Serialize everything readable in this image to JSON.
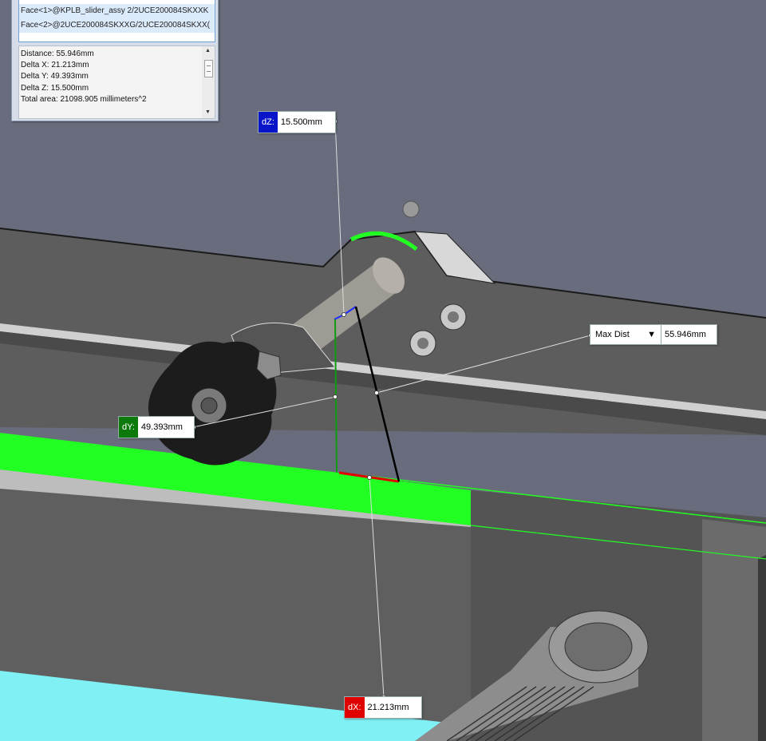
{
  "measure_panel": {
    "selections": [
      "Face<1>@KPLB_slider_assy 2/2UCE200084SKXXK",
      "Face<2>@2UCE200084SKXXG/2UCE200084SKXX("
    ],
    "results": [
      "Distance: 55.946mm",
      "Delta X: 21.213mm",
      "Delta Y: 49.393mm",
      "Delta Z: 15.500mm",
      "Total area: 21098.905 millimeters^2"
    ],
    "scroll_up_icon": "▲",
    "scroll_down_icon": "▼"
  },
  "callouts": {
    "dz": {
      "tag": "dZ:",
      "value": "15.500mm",
      "color": "#0a14c8"
    },
    "dy": {
      "tag": "dY:",
      "value": "49.393mm",
      "color": "#0b7a0b"
    },
    "dx": {
      "tag": "dX:",
      "value": "21.213mm",
      "color": "#e00000"
    }
  },
  "max_dist": {
    "mode": "Max Dist",
    "value": "55.946mm",
    "dropdown_icon": "▼"
  },
  "colors": {
    "background": "#686c7c",
    "part_gray": "#5a5a5a",
    "highlight_green": "#22ff22",
    "highlight_cyan": "#7ff0f4"
  }
}
